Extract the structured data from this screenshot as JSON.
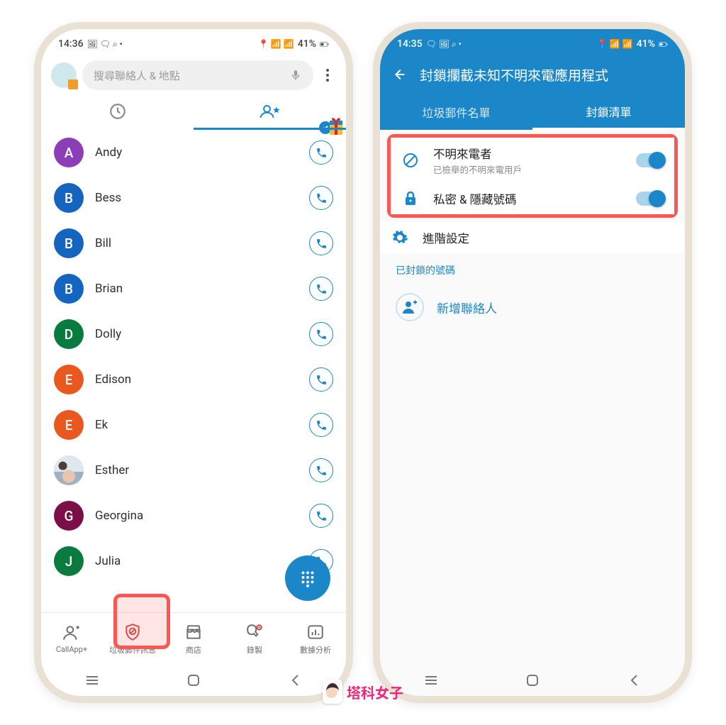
{
  "phone1": {
    "status": {
      "time": "14:36",
      "right": "41%"
    },
    "search": {
      "placeholder": "搜尋聯絡人 & 地點"
    },
    "contacts": [
      {
        "letter": "A",
        "name": "Andy",
        "color": "#8c3db8"
      },
      {
        "letter": "B",
        "name": "Bess",
        "color": "#1565c0"
      },
      {
        "letter": "B",
        "name": "Bill",
        "color": "#1565c0"
      },
      {
        "letter": "B",
        "name": "Brian",
        "color": "#1565c0"
      },
      {
        "letter": "D",
        "name": "Dolly",
        "color": "#0a7b3e"
      },
      {
        "letter": "E",
        "name": "Edison",
        "color": "#e8581f"
      },
      {
        "letter": "E",
        "name": "Ek",
        "color": "#e8581f"
      },
      {
        "letter": "",
        "name": "Esther",
        "color": "photo"
      },
      {
        "letter": "G",
        "name": "Georgina",
        "color": "#7b1048"
      },
      {
        "letter": "J",
        "name": "Julia",
        "color": "#0a7b3e"
      }
    ],
    "nav": [
      {
        "label": "CallApp+"
      },
      {
        "label": "垃圾郵件訊息"
      },
      {
        "label": "商店"
      },
      {
        "label": "錄製"
      },
      {
        "label": "數據分析"
      }
    ]
  },
  "phone2": {
    "status": {
      "time": "14:35",
      "right": "41%"
    },
    "title": "封鎖攔截未知不明來電應用程式",
    "tabs": {
      "left": "垃圾郵件名單",
      "right": "封鎖清單"
    },
    "row1": {
      "title": "不明來電者",
      "sub": "已檢舉的不明來電用戶"
    },
    "row2": {
      "title": "私密 & 隱藏號碼"
    },
    "row3": {
      "title": "進階設定"
    },
    "section": "已封鎖的號碼",
    "add": "新增聯絡人"
  },
  "watermark": "塔科女子"
}
